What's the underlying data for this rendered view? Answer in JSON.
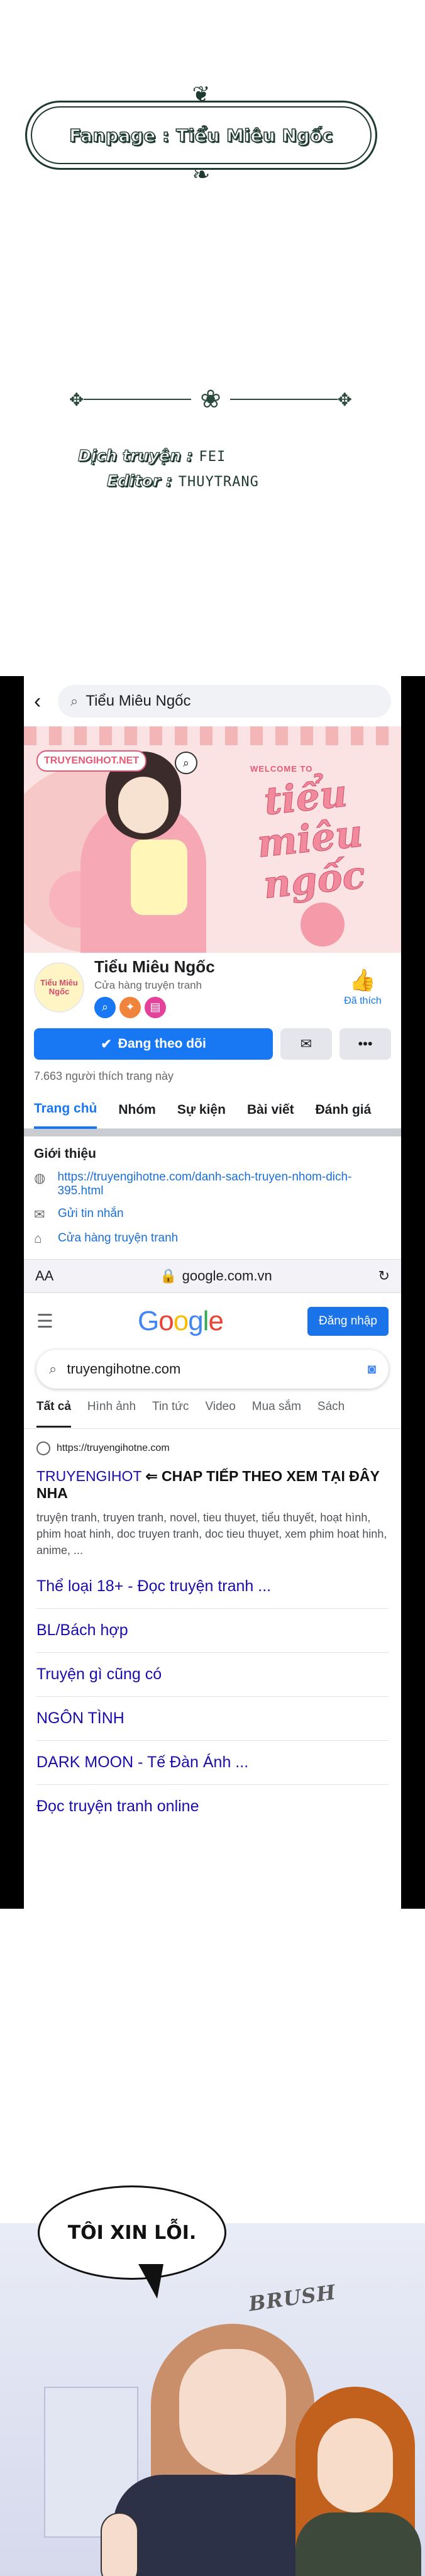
{
  "header": {
    "fanpage_label": "Fanpage : Tiểu Miêu Ngốc",
    "translator_label": "Dịch truyện :",
    "translator_value": "FEI",
    "editor_label": "Editor :",
    "editor_value": "THUYTRANG"
  },
  "facebook": {
    "search_text": "Tiểu Miêu Ngốc",
    "cover": {
      "brand_tag": "TRUYENGIHOT.NET",
      "welcome": "WELCOME TO",
      "title": "tiểu miêu ngốc"
    },
    "page": {
      "avatar_text": "Tiểu Miêu Ngốc",
      "title": "Tiểu Miêu Ngốc",
      "category": "Cửa hàng truyện tranh",
      "liked_label": "Đã thích"
    },
    "follow_label": "Đang theo dõi",
    "likes_count": "7.663 người thích trang này",
    "tabs": [
      "Trang chủ",
      "Nhóm",
      "Sự kiện",
      "Bài viết",
      "Đánh giá"
    ],
    "intro": {
      "heading": "Giới thiệu",
      "link": "https://truyengihotne.com/danh-sach-truyen-nhom-dich-395.html",
      "message": "Gửi tin nhắn",
      "shop": "Cửa hàng truyện tranh"
    }
  },
  "safari": {
    "aa": "AA",
    "url": "google.com.vn"
  },
  "google": {
    "signin_label": "Đăng nhập",
    "query": "truyengihotne.com",
    "tabs": [
      "Tất cả",
      "Hình ảnh",
      "Tin tức",
      "Video",
      "Mua sắm",
      "Sách"
    ],
    "result": {
      "url": "https://truyengihotne.com",
      "title_left": "TRUYENGIHOT",
      "title_right": "⇐ CHAP TIẾP THEO XEM TẠI ĐÂY NHA",
      "snippet": "truyện tranh, truyen tranh, novel, tieu thuyet, tiểu thuyết, hoạt hình, phim hoat hinh, doc truyen tranh, doc tieu thuyet, xem phim hoat hinh, anime, ..."
    },
    "sitelinks": [
      "Thể loại 18+ - Đọc truyện tranh ...",
      "BL/Bách hợp",
      "Truyện gì cũng có",
      "NGÔN TÌNH",
      "DARK MOON - Tế Đàn Ánh ...",
      "Đọc truyện tranh online"
    ]
  },
  "comic": {
    "speech": "TÔI XIN LỖI.",
    "sfx": "BRUSH"
  }
}
